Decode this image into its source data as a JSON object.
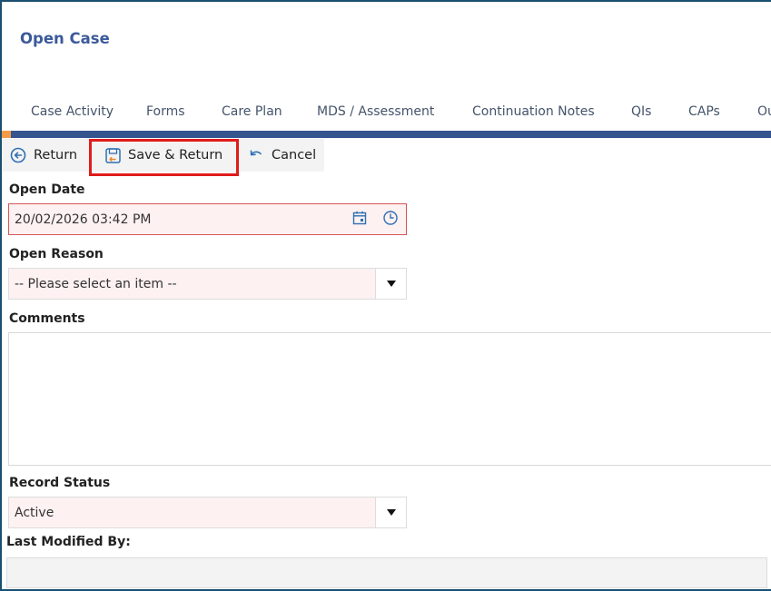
{
  "page": {
    "title": "Open Case"
  },
  "tabs": [
    {
      "label": "Case Activity"
    },
    {
      "label": "Forms"
    },
    {
      "label": "Care Plan"
    },
    {
      "label": "MDS / Assessment"
    },
    {
      "label": "Continuation Notes"
    },
    {
      "label": "QIs"
    },
    {
      "label": "CAPs"
    },
    {
      "label": "Ou"
    }
  ],
  "toolbar": {
    "return_label": "Return",
    "save_return_label": "Save & Return",
    "cancel_label": "Cancel"
  },
  "form": {
    "open_date": {
      "label": "Open Date",
      "value": "20/02/2026 03:42 PM"
    },
    "open_reason": {
      "label": "Open Reason",
      "value": "-- Please select an item --"
    },
    "comments": {
      "label": "Comments",
      "value": ""
    },
    "record_status": {
      "label": "Record Status",
      "value": "Active"
    },
    "last_modified": {
      "label": "Last Modified By:",
      "value": ""
    }
  },
  "colors": {
    "accent": "#36558f",
    "title": "#3b5a9a",
    "highlight": "#e01b1b",
    "marker": "#f39c47",
    "required_field_bg": "#fdf1f1"
  },
  "icons": [
    "return-icon",
    "save-return-icon",
    "cancel-icon",
    "calendar-icon",
    "clock-icon",
    "dropdown-arrow-icon"
  ]
}
